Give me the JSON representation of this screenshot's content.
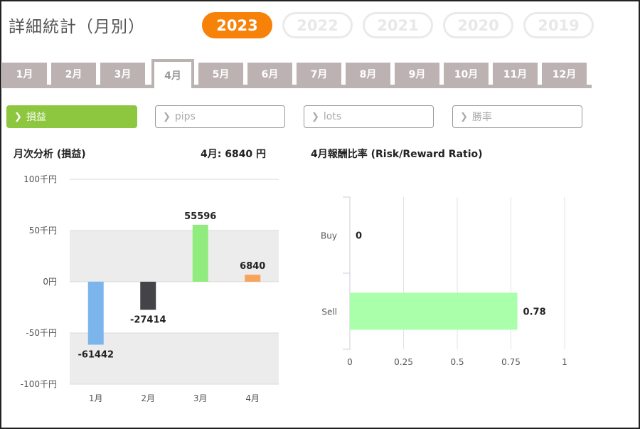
{
  "page_title": "詳細統計（月別）",
  "years": [
    "2023",
    "2022",
    "2021",
    "2020",
    "2019"
  ],
  "active_year_index": 0,
  "months": [
    "1月",
    "2月",
    "3月",
    "4月",
    "5月",
    "6月",
    "7月",
    "8月",
    "9月",
    "10月",
    "11月",
    "12月"
  ],
  "active_month_index": 3,
  "metric_tabs": [
    {
      "label": "損益",
      "active": true
    },
    {
      "label": "pips",
      "active": false
    },
    {
      "label": "lots",
      "active": false
    },
    {
      "label": "勝率",
      "active": false
    }
  ],
  "monthly_chart": {
    "heading": "月次分析 (損益)",
    "summary": "4月:  6840 円"
  },
  "ratio_chart": {
    "heading": "4月報酬比率 (Risk/Reward Ratio)"
  },
  "colors": {
    "accent": "#f7820a",
    "active_metric": "#8dc63f",
    "tab_bg": "#bdb2b2"
  },
  "chart_data": [
    {
      "type": "bar",
      "title": "月次分析 (損益)",
      "categories": [
        "1月",
        "2月",
        "3月",
        "4月"
      ],
      "values": [
        -61442,
        -27414,
        55596,
        6840
      ],
      "bar_colors": [
        "#7cb5ec",
        "#434348",
        "#90ed7d",
        "#f7a35c"
      ],
      "y_ticks": [
        "100千円",
        "50千円",
        "0円",
        "-50千円",
        "-100千円"
      ],
      "ylim": [
        -100000,
        100000
      ],
      "grid": true
    },
    {
      "type": "bar",
      "orientation": "horizontal",
      "title": "4月報酬比率 (Risk/Reward Ratio)",
      "categories": [
        "Buy",
        "Sell"
      ],
      "values": [
        0,
        0.78
      ],
      "bar_color": "#aaffaa",
      "x_ticks": [
        "0",
        "0.25",
        "0.5",
        "0.75",
        "1"
      ],
      "xlim": [
        0,
        1
      ],
      "grid": true
    }
  ]
}
